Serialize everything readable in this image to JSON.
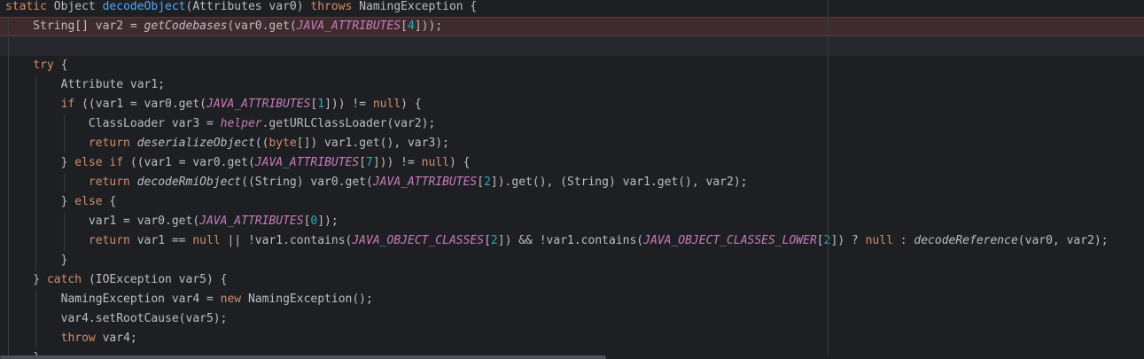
{
  "lines": [
    [
      [
        "kw",
        "static "
      ],
      [
        "pl",
        "Object "
      ],
      [
        "fn",
        "decodeObject"
      ],
      [
        "pl",
        "(Attributes var0) "
      ],
      [
        "kw",
        "throws "
      ],
      [
        "pl",
        "NamingException {"
      ]
    ],
    [
      [
        "pl",
        "    String[] var2 = "
      ],
      [
        "sfn",
        "getCodebases"
      ],
      [
        "pl",
        "(var0.get("
      ],
      [
        "const",
        "JAVA_ATTRIBUTES"
      ],
      [
        "pl",
        "["
      ],
      [
        "num",
        "4"
      ],
      [
        "pl",
        "]));"
      ]
    ],
    [],
    [
      [
        "pl",
        "    "
      ],
      [
        "kw",
        "try "
      ],
      [
        "pl",
        "{"
      ]
    ],
    [
      [
        "pl",
        "        Attribute var1;"
      ]
    ],
    [
      [
        "pl",
        "        "
      ],
      [
        "kw",
        "if "
      ],
      [
        "pl",
        "((var1 = var0.get("
      ],
      [
        "const",
        "JAVA_ATTRIBUTES"
      ],
      [
        "pl",
        "["
      ],
      [
        "num",
        "1"
      ],
      [
        "pl",
        "])) != "
      ],
      [
        "kw",
        "null"
      ],
      [
        "pl",
        ") {"
      ]
    ],
    [
      [
        "pl",
        "            ClassLoader var3 = "
      ],
      [
        "fld",
        "helper"
      ],
      [
        "pl",
        ".getURLClassLoader(var2);"
      ]
    ],
    [
      [
        "pl",
        "            "
      ],
      [
        "kw",
        "return "
      ],
      [
        "sfn",
        "deserializeObject"
      ],
      [
        "pl",
        "(("
      ],
      [
        "kw",
        "byte"
      ],
      [
        "pl",
        "[]) var1.get(), var3);"
      ]
    ],
    [
      [
        "pl",
        "        } "
      ],
      [
        "kw",
        "else if "
      ],
      [
        "pl",
        "((var1 = var0.get("
      ],
      [
        "const",
        "JAVA_ATTRIBUTES"
      ],
      [
        "pl",
        "["
      ],
      [
        "num",
        "7"
      ],
      [
        "pl",
        "])) != "
      ],
      [
        "kw",
        "null"
      ],
      [
        "pl",
        ") {"
      ]
    ],
    [
      [
        "pl",
        "            "
      ],
      [
        "kw",
        "return "
      ],
      [
        "sfn",
        "decodeRmiObject"
      ],
      [
        "pl",
        "((String) var0.get("
      ],
      [
        "const",
        "JAVA_ATTRIBUTES"
      ],
      [
        "pl",
        "["
      ],
      [
        "num",
        "2"
      ],
      [
        "pl",
        "]).get(), (String) var1.get(), var2);"
      ]
    ],
    [
      [
        "pl",
        "        } "
      ],
      [
        "kw",
        "else "
      ],
      [
        "pl",
        "{"
      ]
    ],
    [
      [
        "pl",
        "            var1 = var0.get("
      ],
      [
        "const",
        "JAVA_ATTRIBUTES"
      ],
      [
        "pl",
        "["
      ],
      [
        "num",
        "0"
      ],
      [
        "pl",
        "]);"
      ]
    ],
    [
      [
        "pl",
        "            "
      ],
      [
        "kw",
        "return "
      ],
      [
        "pl",
        "var1 == "
      ],
      [
        "kw",
        "null "
      ],
      [
        "pl",
        "|| !var1.contains("
      ],
      [
        "const",
        "JAVA_OBJECT_CLASSES"
      ],
      [
        "pl",
        "["
      ],
      [
        "num",
        "2"
      ],
      [
        "pl",
        "]) && !var1.contains("
      ],
      [
        "const",
        "JAVA_OBJECT_CLASSES_LOWER"
      ],
      [
        "pl",
        "["
      ],
      [
        "num",
        "2"
      ],
      [
        "pl",
        "]) ? "
      ],
      [
        "kw",
        "null "
      ],
      [
        "pl",
        ": "
      ],
      [
        "sfn",
        "decodeReference"
      ],
      [
        "pl",
        "(var0, var2);"
      ]
    ],
    [
      [
        "pl",
        "        }"
      ]
    ],
    [
      [
        "pl",
        "    } "
      ],
      [
        "kw",
        "catch "
      ],
      [
        "pl",
        "(IOException var5) {"
      ]
    ],
    [
      [
        "pl",
        "        NamingException var4 = "
      ],
      [
        "kw",
        "new "
      ],
      [
        "pl",
        "NamingException();"
      ]
    ],
    [
      [
        "pl",
        "        var4.setRootCause(var5);"
      ]
    ],
    [
      [
        "pl",
        "        "
      ],
      [
        "kw",
        "throw "
      ],
      [
        "pl",
        "var4;"
      ]
    ],
    [
      [
        "pl",
        "    }"
      ]
    ]
  ],
  "highlighted_line": 1,
  "caret_line": 2,
  "colors": {
    "background": "#1e1f22",
    "keyword": "#cf8e6d",
    "method_declaration": "#56a8f5",
    "static_constant": "#c77dbb",
    "number": "#2aacb8",
    "text": "#bcbec4",
    "breakpoint_line": "#3f2b2d"
  }
}
